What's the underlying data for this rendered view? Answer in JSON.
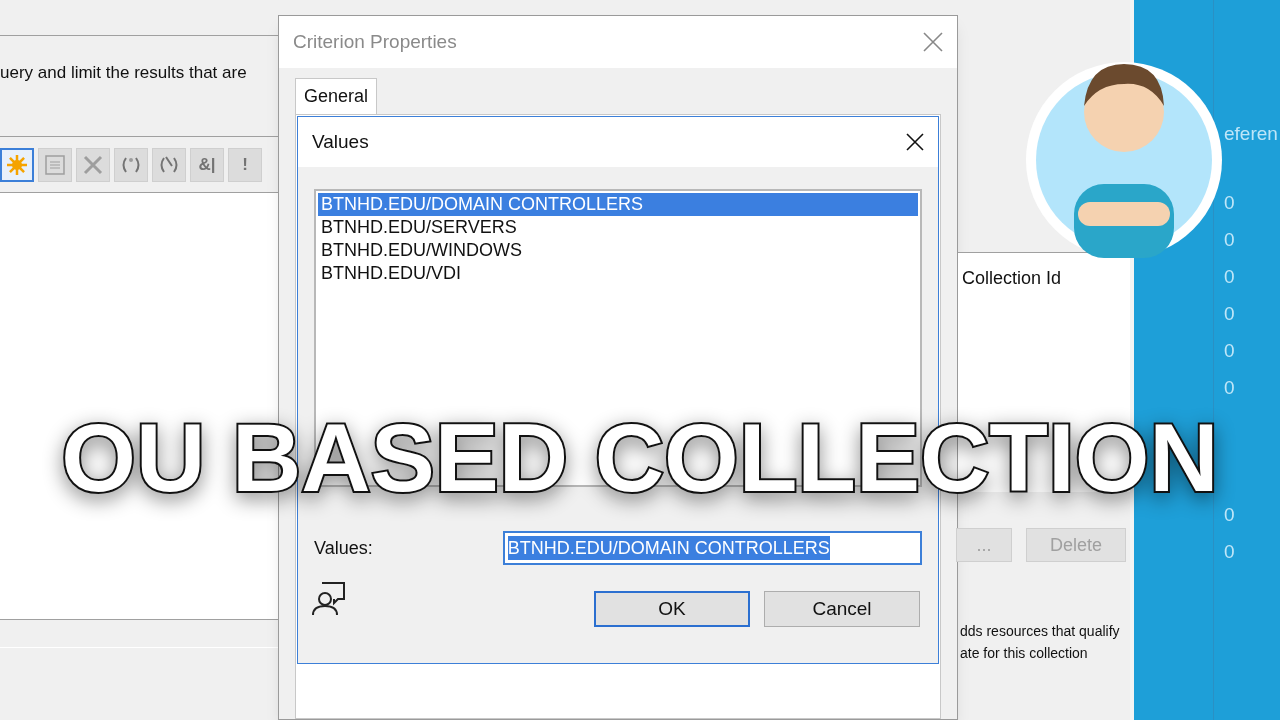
{
  "background_window": {
    "description": "uery and limit the results that are",
    "toolbar": [
      {
        "kind": "sun",
        "selected": true,
        "disabled": false
      },
      {
        "kind": "form",
        "selected": false,
        "disabled": true
      },
      {
        "kind": "cross",
        "selected": false,
        "disabled": true
      },
      {
        "kind": "group",
        "selected": false,
        "disabled": true
      },
      {
        "kind": "ungroup",
        "selected": false,
        "disabled": true
      },
      {
        "kind": "text",
        "label": "&|",
        "selected": false,
        "disabled": true
      },
      {
        "kind": "text",
        "label": "!",
        "selected": false,
        "disabled": true
      }
    ],
    "list_column": "Collection Id",
    "buttons": [
      {
        "label": "...",
        "disabled": true
      },
      {
        "label": "Delete",
        "disabled": true
      }
    ],
    "note_lines": [
      "dds resources that qualify",
      "ate for this collection"
    ]
  },
  "side_panel": {
    "column_header": "eferen",
    "cells": [
      "0",
      "0",
      "0",
      "0",
      "0",
      "0",
      "0",
      "0"
    ]
  },
  "criterion_dialog": {
    "title": "Criterion Properties",
    "tabs": [
      {
        "label": "General",
        "selected": true
      }
    ],
    "values_dialog": {
      "title": "Values",
      "items": [
        {
          "label": "BTNHD.EDU/DOMAIN CONTROLLERS",
          "selected": true
        },
        {
          "label": "BTNHD.EDU/SERVERS",
          "selected": false
        },
        {
          "label": "BTNHD.EDU/WINDOWS",
          "selected": false
        },
        {
          "label": "BTNHD.EDU/VDI",
          "selected": false
        }
      ],
      "field_label": "Values:",
      "field_value": "BTNHD.EDU/DOMAIN CONTROLLERS",
      "buttons": [
        {
          "label": "OK",
          "default": true
        },
        {
          "label": "Cancel",
          "default": false
        }
      ]
    }
  },
  "overlay_title": "OU BASED COLLECTION"
}
